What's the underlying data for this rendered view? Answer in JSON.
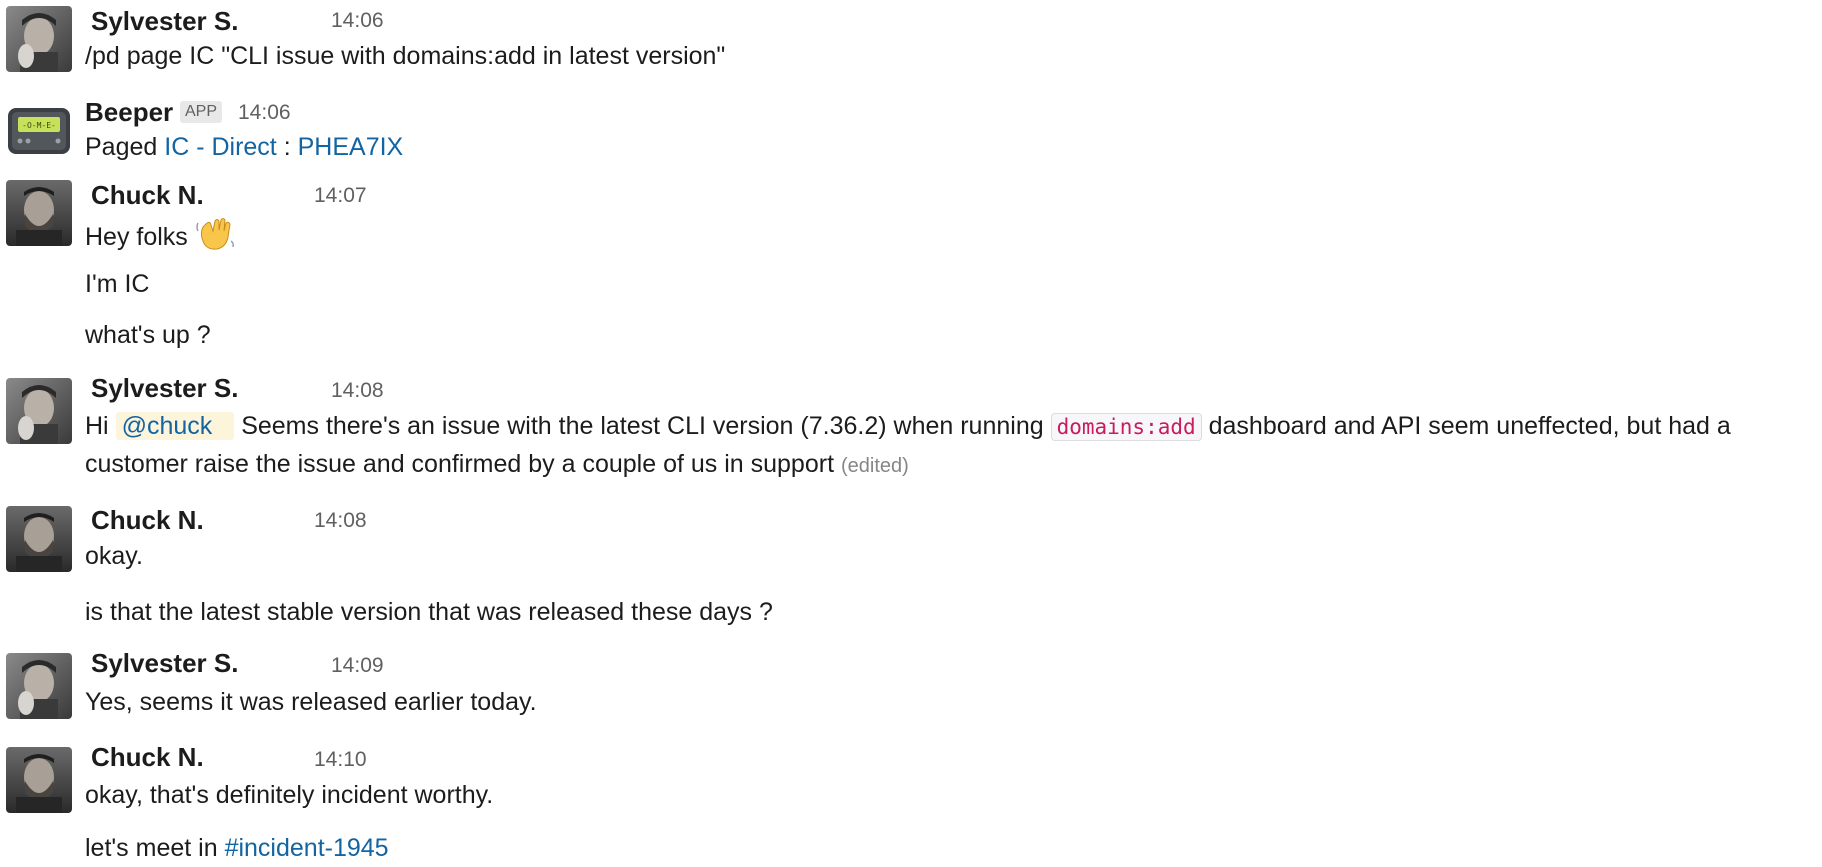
{
  "messages": [
    {
      "author": "Sylvester S.",
      "time": "14:06",
      "avatar": "sylvester-avatar",
      "lines": [
        "/pd page IC \"CLI issue with domains:add in latest version\""
      ]
    },
    {
      "author": "Beeper",
      "badge": "APP",
      "time": "14:06",
      "avatar": "pager-icon",
      "pager_screen": "-O-M-E-",
      "prefix": "Paged",
      "link1": "IC - Direct",
      "separator": ":",
      "link2": "PHEA7IX"
    },
    {
      "author": "Chuck N.",
      "time": "14:07",
      "avatar": "chuck-avatar",
      "lines": [
        "Hey folks",
        "I'm IC",
        "what's up ?"
      ],
      "emoji": "waving-hand-emoji"
    },
    {
      "author": "Sylvester S.",
      "time": "14:08",
      "avatar": "sylvester-avatar",
      "greeting": "Hi",
      "mention": "@chuck",
      "text_before_code": "Seems there's an issue with the latest CLI version (7.36.2) when running",
      "code": "domains:add",
      "text_after_code": "dashboard and API seem uneffected, but had a",
      "line2": "customer raise the issue and confirmed by a couple of us in support",
      "edited": "(edited)"
    },
    {
      "author": "Chuck N.",
      "time": "14:08",
      "avatar": "chuck-avatar",
      "lines": [
        "okay.",
        "is that the latest stable version that was released these days ?"
      ]
    },
    {
      "author": "Sylvester S.",
      "time": "14:09",
      "avatar": "sylvester-avatar",
      "lines": [
        "Yes, seems it was released earlier today."
      ]
    },
    {
      "author": "Chuck N.",
      "time": "14:10",
      "avatar": "chuck-avatar",
      "lines": [
        "okay, that's definitely incident worthy."
      ],
      "prefix2": "let's meet in",
      "channel": "#incident-1945"
    }
  ],
  "colors": {
    "link": "#1264a3",
    "mention_bg": "#fdf4dc",
    "code_text": "#c91b5d",
    "timestamp": "#616061"
  }
}
